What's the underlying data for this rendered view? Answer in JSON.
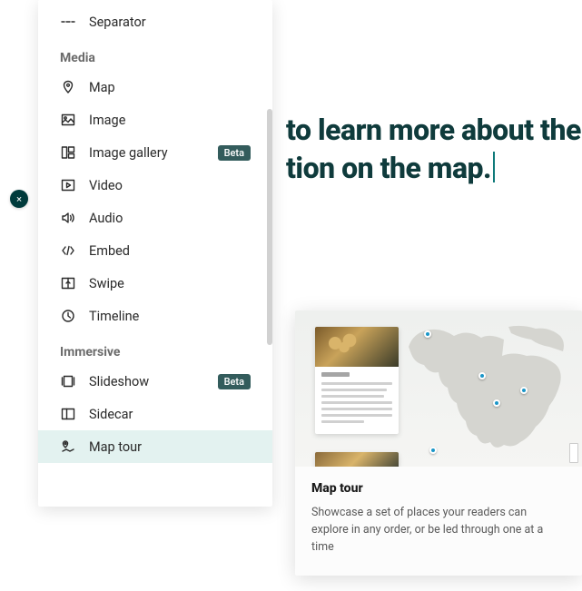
{
  "background": {
    "line1": "to learn more about the",
    "line2": "tion on the map."
  },
  "close_button": "×",
  "panel": {
    "items": [
      {
        "type": "item",
        "icon": "separator",
        "label": "Separator"
      },
      {
        "type": "header",
        "label": "Media"
      },
      {
        "type": "item",
        "icon": "map",
        "label": "Map"
      },
      {
        "type": "item",
        "icon": "image",
        "label": "Image"
      },
      {
        "type": "item",
        "icon": "gallery",
        "label": "Image gallery",
        "badge": "Beta"
      },
      {
        "type": "item",
        "icon": "video",
        "label": "Video"
      },
      {
        "type": "item",
        "icon": "audio",
        "label": "Audio"
      },
      {
        "type": "item",
        "icon": "embed",
        "label": "Embed"
      },
      {
        "type": "item",
        "icon": "swipe",
        "label": "Swipe"
      },
      {
        "type": "item",
        "icon": "timeline",
        "label": "Timeline"
      },
      {
        "type": "header",
        "label": "Immersive"
      },
      {
        "type": "item",
        "icon": "slideshow",
        "label": "Slideshow",
        "badge": "Beta"
      },
      {
        "type": "item",
        "icon": "sidecar",
        "label": "Sidecar"
      },
      {
        "type": "item",
        "icon": "maptour",
        "label": "Map tour",
        "selected": true
      }
    ]
  },
  "tooltip": {
    "title": "Map tour",
    "description": "Showcase a set of places your readers can explore in any order, or be led through one at a time"
  }
}
